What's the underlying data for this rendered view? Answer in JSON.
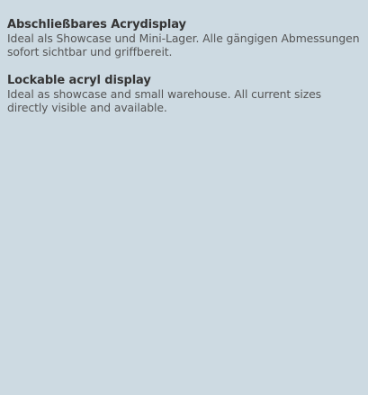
{
  "blocks": [
    {
      "heading": "Abschließbares Acrydisplay",
      "text": "Ideal als Showcase und Mini-Lager. Alle gängigen Abmessungen sofort sichtbar und griffbereit."
    },
    {
      "heading": "Lockable acryl display",
      "text": "Ideal as showcase and small warehouse. All current sizes directly visible and available."
    }
  ],
  "colors": {
    "background": "#cddae2",
    "heading": "#353535",
    "text": "#555555"
  }
}
